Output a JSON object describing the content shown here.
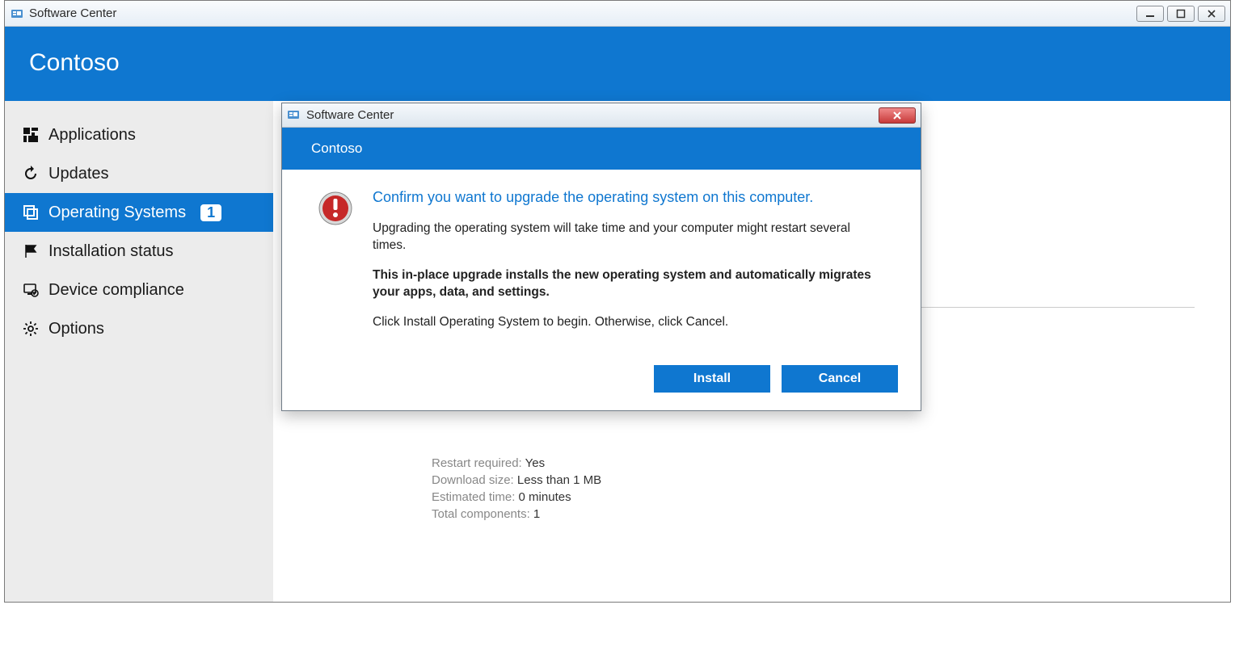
{
  "window": {
    "title": "Software Center"
  },
  "brand": "Contoso",
  "sidebar": {
    "items": [
      {
        "label": "Applications"
      },
      {
        "label": "Updates"
      },
      {
        "label": "Operating Systems",
        "badge": "1"
      },
      {
        "label": "Installation status"
      },
      {
        "label": "Device compliance"
      },
      {
        "label": "Options"
      }
    ]
  },
  "details": {
    "restart_label": "Restart required:",
    "restart_value": "Yes",
    "size_label": "Download size:",
    "size_value": "Less than 1 MB",
    "time_label": "Estimated time:",
    "time_value": "0 minutes",
    "components_label": "Total components:",
    "components_value": "1"
  },
  "dialog": {
    "title": "Software Center",
    "brand": "Contoso",
    "heading": "Confirm you want to upgrade the operating system on this computer.",
    "para1": "Upgrading the operating system will take time and your computer might restart several times.",
    "para2": "This in-place upgrade installs the new operating system and automatically migrates your apps, data, and settings.",
    "para3": "Click Install Operating System to begin. Otherwise, click Cancel.",
    "install_label": "Install",
    "cancel_label": "Cancel"
  }
}
